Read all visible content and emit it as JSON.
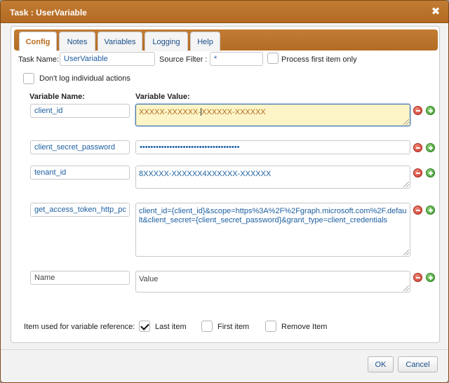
{
  "dialog": {
    "title": "Task : UserVariable",
    "close_icon": "close-icon"
  },
  "tabs": [
    {
      "label": "Config",
      "active": true
    },
    {
      "label": "Notes",
      "active": false
    },
    {
      "label": "Variables",
      "active": false
    },
    {
      "label": "Logging",
      "active": false
    },
    {
      "label": "Help",
      "active": false
    }
  ],
  "config": {
    "task_name_label": "Task Name:",
    "task_name_value": "UserVariable",
    "source_filter_label": "Source Filter :",
    "source_filter_value": "*",
    "process_first_label": "Process first item only",
    "process_first_checked": false,
    "dont_log_label": "Don't log individual actions",
    "dont_log_checked": false,
    "variable_name_header": "Variable Name:",
    "variable_value_header": "Variable Value:"
  },
  "variables": [
    {
      "name": "client_id",
      "value_before_caret": "XXXXX-XXXXXX-",
      "value_after_caret": "XXXXXX-XXXXXX"
    },
    {
      "name": "client_secret_password",
      "value": "•••••••••••••••••••••••••••••••••••••"
    },
    {
      "name": "tenant_id",
      "value": "8XXXXX-XXXXXX4XXXXXX-XXXXXX"
    },
    {
      "name": "get_access_token_http_pc",
      "value": "client_id={client_id}&scope=https%3A%2F%2Fgraph.microsoft.com%2F.default&client_secret={client_secret_password}&grant_type=client_credentials"
    },
    {
      "name_placeholder": "Name",
      "value_placeholder": "Value"
    }
  ],
  "reference": {
    "label": "Item used for variable reference:",
    "options": [
      {
        "label": "Last item",
        "checked": true
      },
      {
        "label": "First item",
        "checked": false
      },
      {
        "label": "Remove Item",
        "checked": false
      }
    ]
  },
  "footer": {
    "ok_label": "OK",
    "cancel_label": "Cancel"
  },
  "colors": {
    "title_bar": "#b8712a",
    "active_tab_text": "#b96a1c",
    "link_text": "#1d5fa0",
    "focused_field_bg": "#fdf5c8"
  }
}
